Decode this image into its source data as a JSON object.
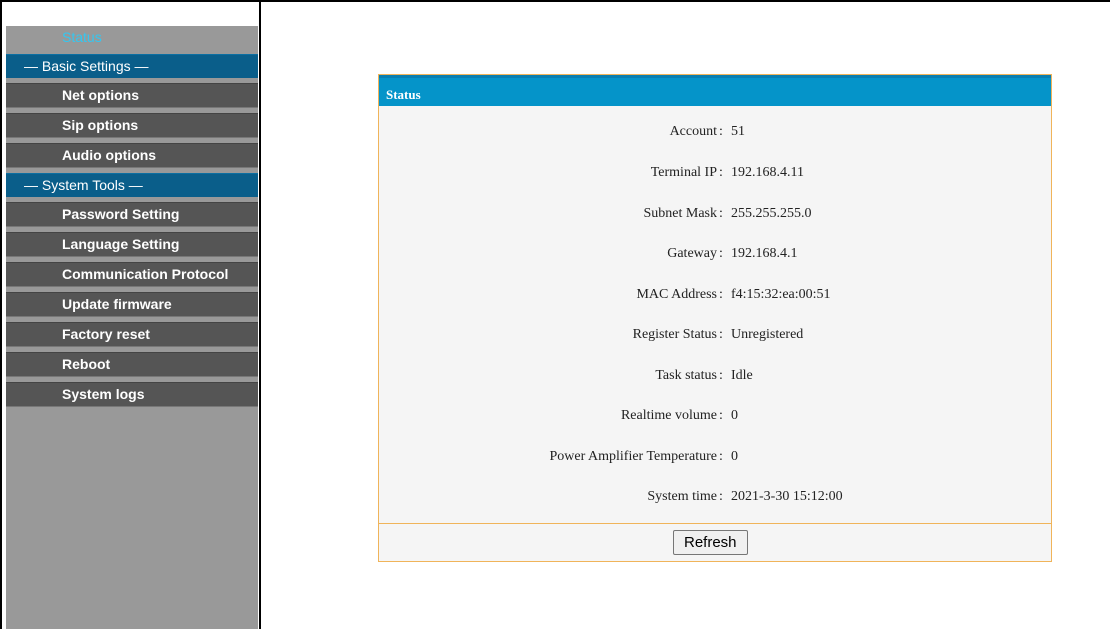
{
  "sidebar": {
    "items": [
      {
        "label": "Status",
        "kind": "active"
      },
      {
        "label": "— Basic Settings —",
        "kind": "section"
      },
      {
        "label": "Net options",
        "kind": "link"
      },
      {
        "label": "Sip options",
        "kind": "link"
      },
      {
        "label": "Audio options",
        "kind": "link"
      },
      {
        "label": "— System Tools —",
        "kind": "section"
      },
      {
        "label": "Password Setting",
        "kind": "link"
      },
      {
        "label": "Language Setting",
        "kind": "link"
      },
      {
        "label": "Communication Protocol",
        "kind": "link"
      },
      {
        "label": "Update firmware",
        "kind": "link"
      },
      {
        "label": "Factory reset",
        "kind": "link"
      },
      {
        "label": "Reboot",
        "kind": "link"
      },
      {
        "label": "System logs",
        "kind": "link"
      }
    ]
  },
  "panel": {
    "title": "Status",
    "colon": ":",
    "rows": [
      {
        "label": "Account",
        "value": "51"
      },
      {
        "label": "Terminal IP",
        "value": "192.168.4.11"
      },
      {
        "label": "Subnet Mask",
        "value": "255.255.255.0"
      },
      {
        "label": "Gateway",
        "value": "192.168.4.1"
      },
      {
        "label": "MAC Address",
        "value": "f4:15:32:ea:00:51"
      },
      {
        "label": "Register Status",
        "value": "Unregistered"
      },
      {
        "label": "Task status",
        "value": "Idle"
      },
      {
        "label": "Realtime volume",
        "value": "0"
      },
      {
        "label": "Power Amplifier Temperature",
        "value": "0"
      },
      {
        "label": "System time",
        "value": "2021-3-30 15:12:00"
      }
    ],
    "refresh_label": "Refresh"
  },
  "colors": {
    "header": "#0594c9",
    "section": "#0a5e8a",
    "active_text": "#34c7f0",
    "panel_border": "#f0b45a"
  }
}
